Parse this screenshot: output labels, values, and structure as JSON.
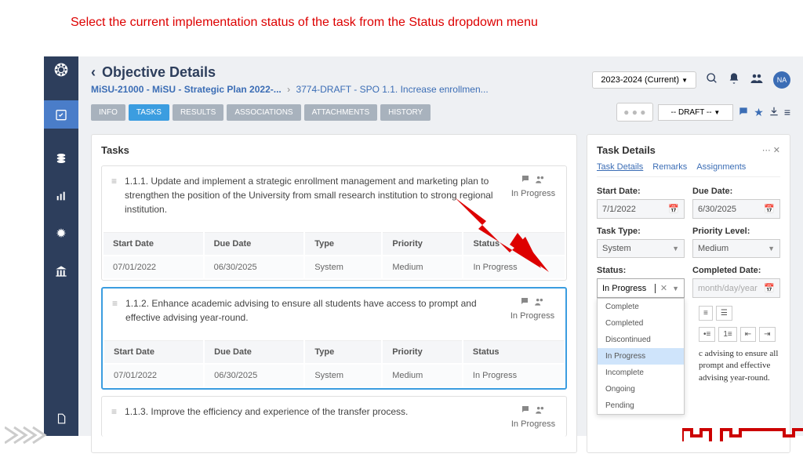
{
  "instruction": "Select the current implementation status of the task from the Status dropdown menu",
  "page_title": "Objective Details",
  "breadcrumb": {
    "plan": "MiSU-21000 - MiSU - Strategic Plan 2022-...",
    "objective": "3774-DRAFT - SPO 1.1. Increase enrollmen..."
  },
  "year_selector": "2023-2024 (Current)",
  "avatar_initials": "NA",
  "tabs": {
    "info": "INFO",
    "tasks": "TASKS",
    "results": "RESULTS",
    "associations": "ASSOCIATIONS",
    "attachments": "ATTACHMENTS",
    "history": "HISTORY"
  },
  "draft_label": "-- DRAFT --",
  "tasks_panel_title": "Tasks",
  "table_headers": {
    "start": "Start Date",
    "due": "Due Date",
    "type": "Type",
    "priority": "Priority",
    "status": "Status"
  },
  "tasks": [
    {
      "title": "1.1.1. Update and implement a strategic enrollment management and marketing plan to strengthen the position of the University from small research institution to strong regional institution.",
      "status": "In Progress",
      "start": "07/01/2022",
      "due": "06/30/2025",
      "type": "System",
      "priority": "Medium",
      "row_status": "In Progress"
    },
    {
      "title": "1.1.2. Enhance academic advising to ensure all students have access to prompt and effective advising year-round.",
      "status": "In Progress",
      "start": "07/01/2022",
      "due": "06/30/2025",
      "type": "System",
      "priority": "Medium",
      "row_status": "In Progress"
    },
    {
      "title": "1.1.3. Improve the efficiency and experience of the transfer process.",
      "status": "In Progress"
    }
  ],
  "details": {
    "title": "Task Details",
    "subtabs": {
      "details": "Task Details",
      "remarks": "Remarks",
      "assignments": "Assignments"
    },
    "labels": {
      "start": "Start Date:",
      "due": "Due Date:",
      "tasktype": "Task Type:",
      "priority": "Priority Level:",
      "status": "Status:",
      "completed": "Completed Date:"
    },
    "values": {
      "start": "7/1/2022",
      "due": "6/30/2025",
      "tasktype": "System",
      "priority": "Medium",
      "status": "In Progress",
      "completed_placeholder": "month/day/year"
    },
    "status_options": [
      "Complete",
      "Completed",
      "Discontinued",
      "In Progress",
      "Incomplete",
      "Ongoing",
      "Pending"
    ],
    "description_tail": "c advising to ensure all prompt and effective advising year-round."
  }
}
